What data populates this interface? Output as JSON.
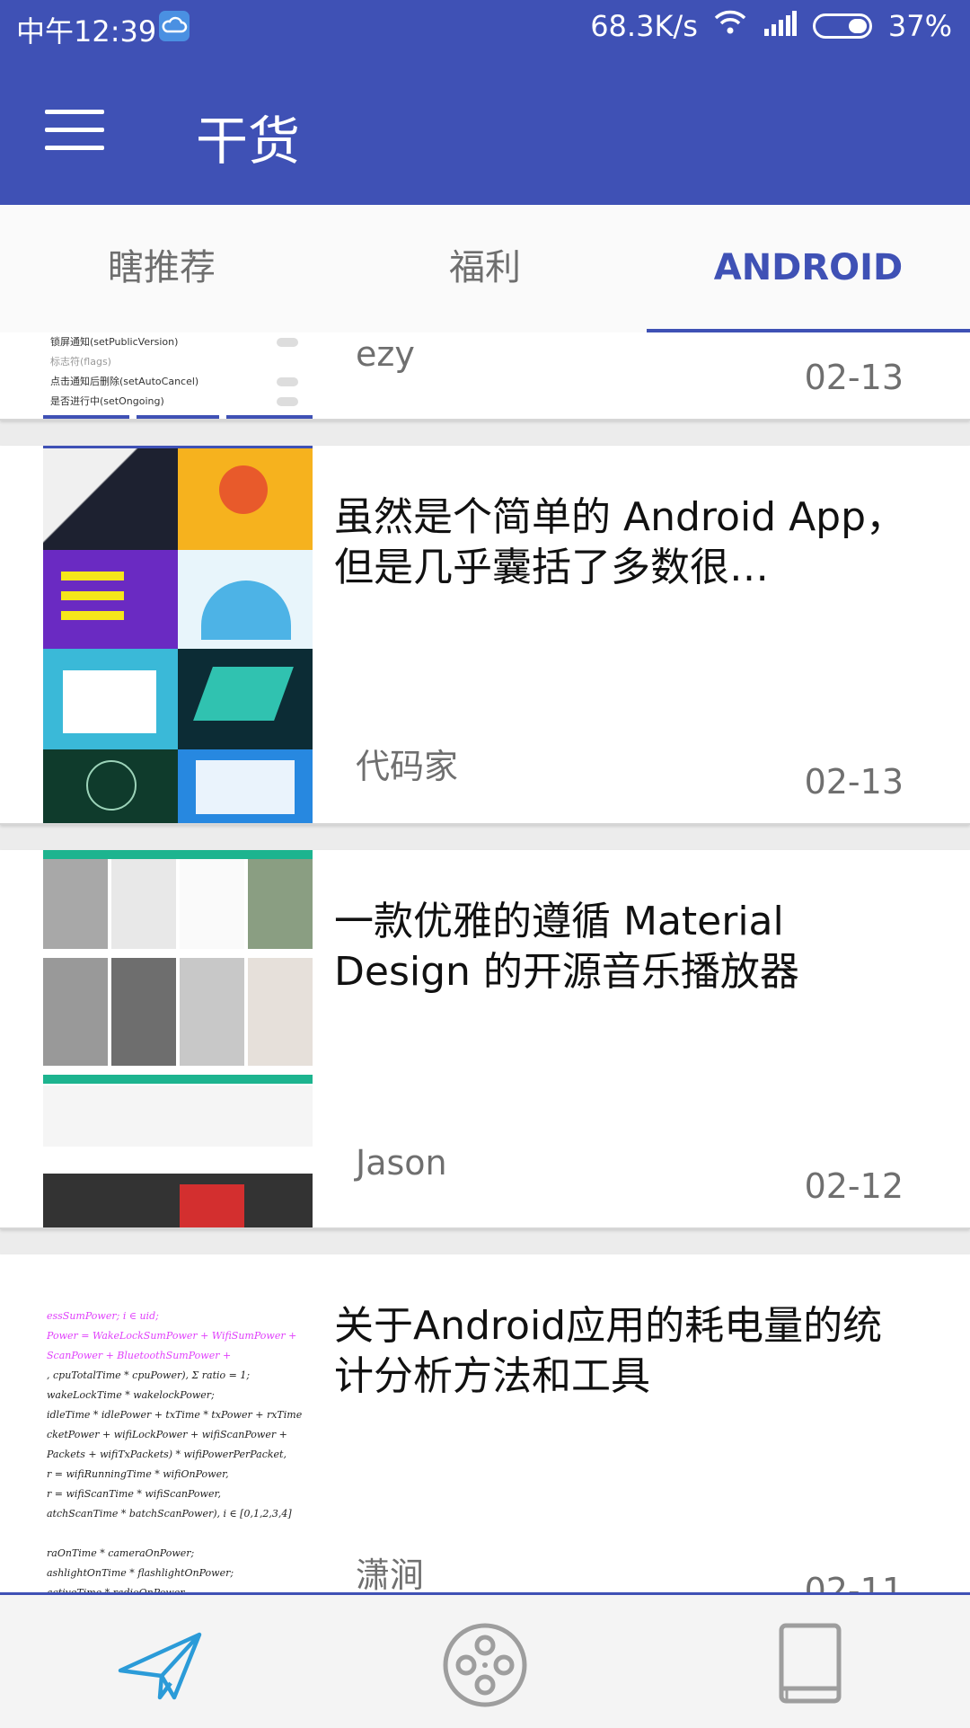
{
  "status_bar": {
    "time": "中午12:39",
    "net_speed": "68.3K/s",
    "battery": "37%"
  },
  "app_bar": {
    "title": "干货"
  },
  "tabs": [
    {
      "label": "瞎推荐",
      "active": false
    },
    {
      "label": "福利",
      "active": false
    },
    {
      "label": "ANDROID",
      "active": true
    }
  ],
  "items": [
    {
      "title": "",
      "author": "ezy",
      "date": "02-13",
      "thumb_lines": [
        "锁屏通知(setPublicVersion)",
        "标志符(flags)",
        "点击通知后删除(setAutoCancel)",
        "是否进行中(setOngoing)"
      ]
    },
    {
      "title": "虽然是个简单的 Android App，但是几乎囊括了多数很…",
      "author": "代码家",
      "date": "02-13"
    },
    {
      "title": "一款优雅的遵循 Material Design 的开源音乐播放器",
      "author": "Jason",
      "date": "02-12"
    },
    {
      "title": "关于Android应用的耗电量的统计分析方法和工具",
      "author": "潇涧",
      "date": "02-11"
    }
  ],
  "bottom_nav": [
    {
      "icon": "paper-plane-icon",
      "active": true
    },
    {
      "icon": "film-reel-icon",
      "active": false
    },
    {
      "icon": "book-icon",
      "active": false
    }
  ],
  "colors": {
    "primary": "#3f51b5",
    "active_nav": "#2b9bd8"
  }
}
